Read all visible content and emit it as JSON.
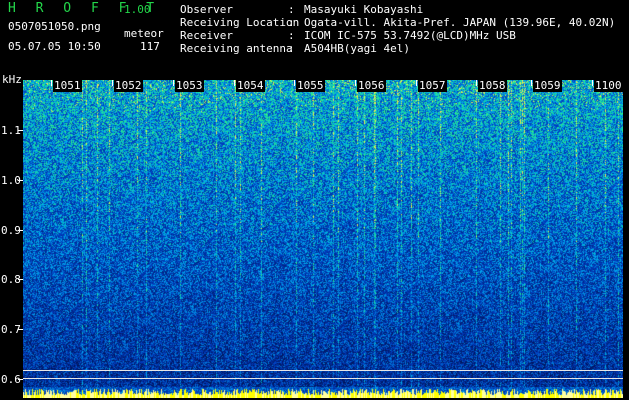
{
  "header": {
    "title": "H R O F F T",
    "version": "1.00",
    "filename": "0507051050.png",
    "mode": "meteor",
    "datetime": "05.07.05 10:50",
    "count": "117"
  },
  "info": {
    "rows": [
      {
        "key": "Observer",
        "value": "Masayuki Kobayashi"
      },
      {
        "key": "Receiving Location",
        "value": "Ogata-vill. Akita-Pref. JAPAN (139.96E, 40.02N)"
      },
      {
        "key": "Receiver",
        "value": "ICOM IC-575 53.7492(@LCD)MHz USB"
      },
      {
        "key": "Receiving antenna",
        "value": "A504HB(yagi 4el)"
      }
    ],
    "separator": ":"
  },
  "axis": {
    "unit": "kHz",
    "y_ticks": [
      "1.1",
      "1.0",
      "0.9",
      "0.8",
      "0.7",
      "0.6"
    ],
    "x_ticks": [
      "1051",
      "1052",
      "1053",
      "1054",
      "1055",
      "1056",
      "1057",
      "1058",
      "1059",
      "1100"
    ]
  },
  "colors": {
    "title": "#23d64a",
    "background": "#000000",
    "spectrogram_base": "#0a1a8a",
    "noise_bottom_band": "#ffff00"
  }
}
